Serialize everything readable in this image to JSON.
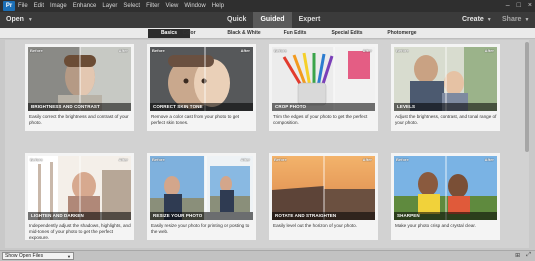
{
  "menubar": {
    "logo": "Pr",
    "items": [
      "File",
      "Edit",
      "Image",
      "Enhance",
      "Layer",
      "Select",
      "Filter",
      "View",
      "Window",
      "Help"
    ],
    "window_controls": [
      "–",
      "□",
      "×"
    ]
  },
  "modebar": {
    "open_label": "Open",
    "modes": [
      "Quick",
      "Guided",
      "Expert"
    ],
    "active_mode": "Guided",
    "create_label": "Create",
    "share_label": "Share"
  },
  "categories": {
    "tabs": [
      "Basics",
      "Color",
      "Black & White",
      "Fun Edits",
      "Special Edits",
      "Photomerge"
    ],
    "active": "Basics"
  },
  "cards": [
    {
      "title": "BRIGHTNESS AND CONTRAST",
      "desc": "Easily correct the brightness and contrast of your photo.",
      "before": "Before",
      "after": "After"
    },
    {
      "title": "CORRECT SKIN TONE",
      "desc": "Remove a color cast from your photo to get perfect skin tones.",
      "before": "Before",
      "after": "After"
    },
    {
      "title": "CROP PHOTO",
      "desc": "Trim the edges of your photo to get the perfect composition.",
      "before": "Before",
      "after": "After"
    },
    {
      "title": "LEVELS",
      "desc": "Adjust the brightness, contrast, and tonal range of your photo.",
      "before": "Before",
      "after": "After"
    },
    {
      "title": "LIGHTEN AND DARKEN",
      "desc": "Independently adjust the shadows, highlights, and mid-tones of your photo to get the perfect exposure.",
      "before": "Before",
      "after": "After"
    },
    {
      "title": "RESIZE YOUR PHOTO",
      "desc": "Easily resize your photo for printing or posting to the web.",
      "before": "Before",
      "after": "After"
    },
    {
      "title": "ROTATE AND STRAIGHTEN",
      "desc": "Easily level out the horizon of your photo.",
      "before": "Before",
      "after": "After"
    },
    {
      "title": "SHARPEN",
      "desc": "Make your photo crisp and crystal clear.",
      "before": "Before",
      "after": "After"
    }
  ],
  "statusbar": {
    "select_value": "Show Open Files",
    "right_icons": [
      "⊞",
      "⤢"
    ]
  }
}
